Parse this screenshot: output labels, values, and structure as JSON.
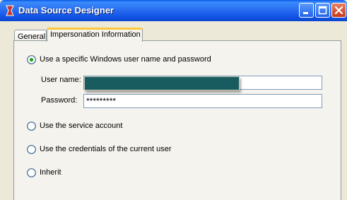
{
  "window": {
    "title": "Data Source Designer",
    "icons": {
      "app": "app-icon",
      "minimize": "minimize-icon",
      "maximize": "maximize-icon",
      "close": "close-icon"
    }
  },
  "tabs": [
    {
      "label": "General",
      "active": false
    },
    {
      "label": "Impersonation Information",
      "active": true
    }
  ],
  "options": [
    {
      "label": "Use a specific Windows user name and password",
      "checked": true
    },
    {
      "label": "Use the service account",
      "checked": false
    },
    {
      "label": "Use the credentials of the current user",
      "checked": false
    },
    {
      "label": "Inherit",
      "checked": false
    }
  ],
  "fields": {
    "username_label": "User name:",
    "username_value": "",
    "password_label": "Password:",
    "password_value": "*********"
  },
  "colors": {
    "redaction": "#185C60",
    "titlebar": "#2A6EF2",
    "tab_highlight": "#FFC83C"
  }
}
